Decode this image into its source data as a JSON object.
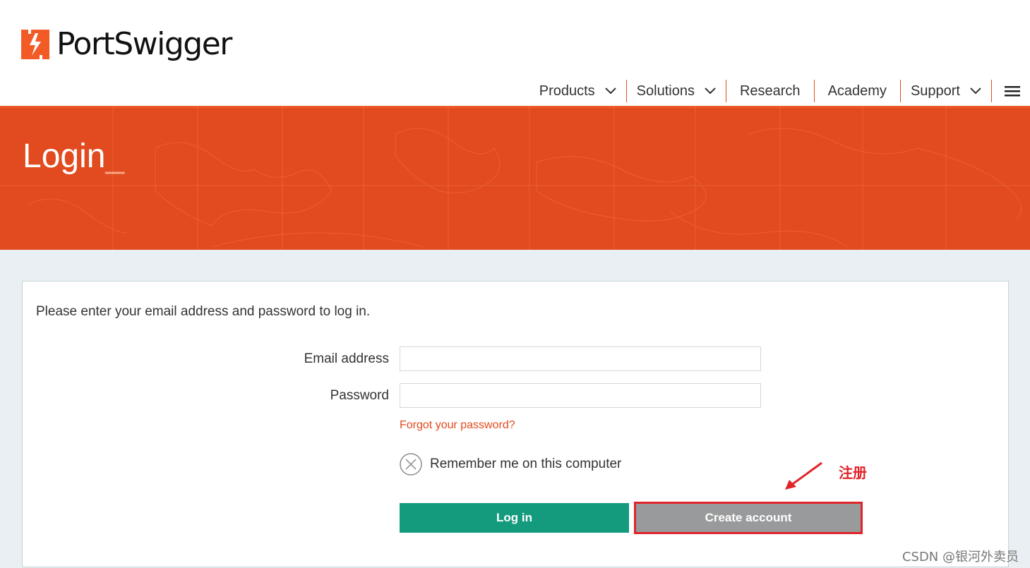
{
  "brand": {
    "name": "PortSwigger",
    "accent": "#e24a1f"
  },
  "nav": {
    "items": [
      {
        "label": "Products",
        "has_dropdown": true
      },
      {
        "label": "Solutions",
        "has_dropdown": true
      },
      {
        "label": "Research",
        "has_dropdown": false
      },
      {
        "label": "Academy",
        "has_dropdown": false
      },
      {
        "label": "Support",
        "has_dropdown": true
      }
    ],
    "menu_icon": "hamburger-icon"
  },
  "banner": {
    "title": "Login",
    "cursor": "_"
  },
  "form": {
    "intro": "Please enter your email address and password to log in.",
    "email_label": "Email address",
    "email_value": "",
    "password_label": "Password",
    "password_value": "",
    "forgot_link": "Forgot your password?",
    "remember_label": "Remember me on this computer",
    "remember_checked": false,
    "login_button": "Log in",
    "create_button": "Create account"
  },
  "colors": {
    "login_button": "#149b7e",
    "create_button": "#999a9b",
    "highlight": "#e0242a"
  },
  "annotation": {
    "text": "注册"
  },
  "watermark": "CSDN @银河外卖员"
}
